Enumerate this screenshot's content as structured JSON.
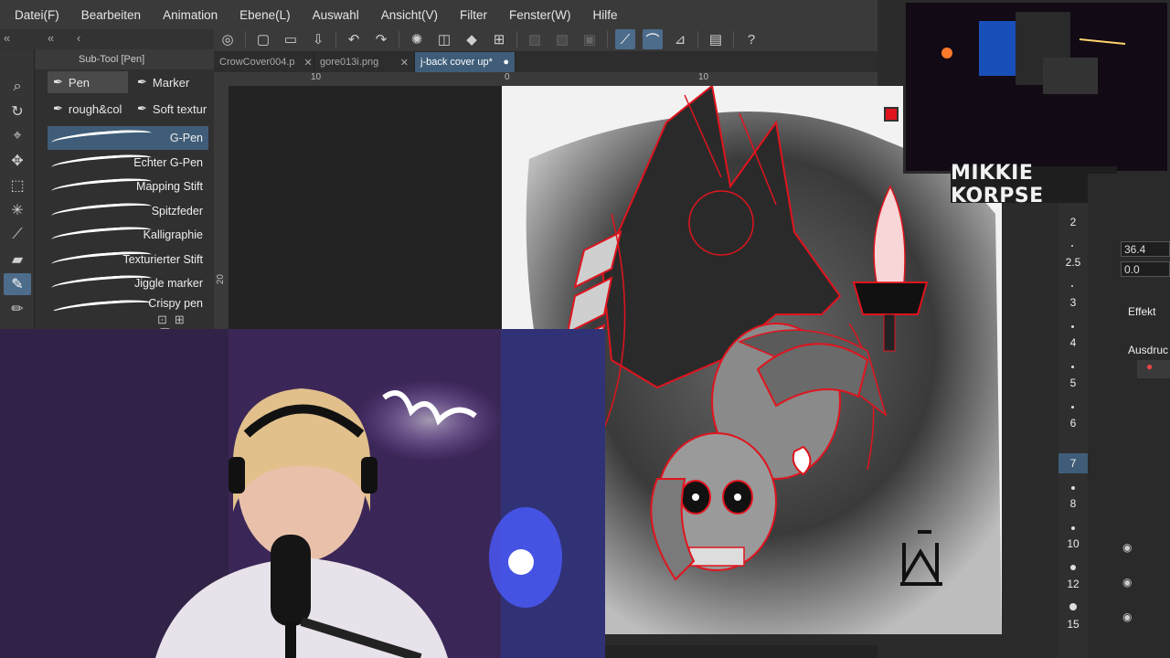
{
  "menubar": {
    "items": [
      "Datei(F)",
      "Bearbeiten",
      "Animation",
      "Ebene(L)",
      "Auswahl",
      "Ansicht(V)",
      "Filter",
      "Fenster(W)",
      "Hilfe"
    ]
  },
  "subtool": {
    "header": "Sub-Tool [Pen]",
    "groups": [
      "Pen",
      "Marker",
      "rough&col",
      "Soft textur"
    ],
    "brushes": [
      "G-Pen",
      "Echter G-Pen",
      "Mapping Stift",
      "Spitzfeder",
      "Kalligraphie",
      "Texturierter Stift",
      "Jiggle marker",
      "Crispy pen"
    ]
  },
  "tabs": [
    {
      "label": "CrowCover004.p"
    },
    {
      "label": "gore013i.png"
    },
    {
      "label": "j-back cover up*"
    }
  ],
  "ruler": {
    "top": [
      "10",
      "0",
      "10"
    ],
    "left": "20"
  },
  "overlay": {
    "name": "MIKKIE KORPSE"
  },
  "brush_sizes": [
    "2",
    "2.5",
    "3",
    "4",
    "5",
    "6",
    "7",
    "8",
    "10",
    "12",
    "15"
  ],
  "selected_size": "7",
  "fields": {
    "value1": "36.4",
    "value2": "0.0"
  },
  "panel_labels": {
    "effect": "Effekt",
    "expression": "Ausdruc"
  },
  "colors": {
    "accent": "#3f5d78",
    "menubar": "#3a3a3a",
    "ink_red": "#e0141e"
  }
}
